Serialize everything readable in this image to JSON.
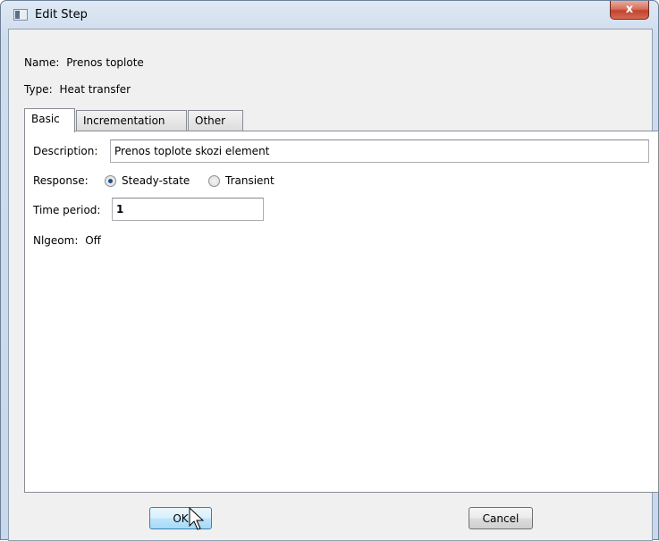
{
  "window": {
    "title": "Edit Step",
    "close_glyph": "x"
  },
  "step": {
    "name_label": "Name:",
    "name_value": "Prenos toplote",
    "type_label": "Type:",
    "type_value": "Heat transfer"
  },
  "tabs": [
    {
      "label": "Basic",
      "active": true
    },
    {
      "label": "Incrementation",
      "active": false
    },
    {
      "label": "Other",
      "active": false
    }
  ],
  "basic": {
    "description_label": "Description:",
    "description_value": "Prenos toplote skozi element",
    "response_label": "Response:",
    "response_options": [
      {
        "label": "Steady-state",
        "selected": true
      },
      {
        "label": "Transient",
        "selected": false
      }
    ],
    "time_period_label": "Time period:",
    "time_period_value": "1",
    "nlgeom_label": "Nlgeom:",
    "nlgeom_value": "Off"
  },
  "buttons": {
    "ok_label": "OK",
    "cancel_label": "Cancel"
  },
  "icons": {
    "title": "window-icon",
    "close": "close-icon",
    "cursor": "mouse-cursor-icon"
  },
  "colors": {
    "title_bg": "#cfdcec",
    "close_btn": "#c2432e",
    "dialog_bg": "#f0f0f0",
    "panel_bg": "#ffffff",
    "default_btn": "#bee6fd",
    "radio_dot": "#1f4f8a"
  }
}
